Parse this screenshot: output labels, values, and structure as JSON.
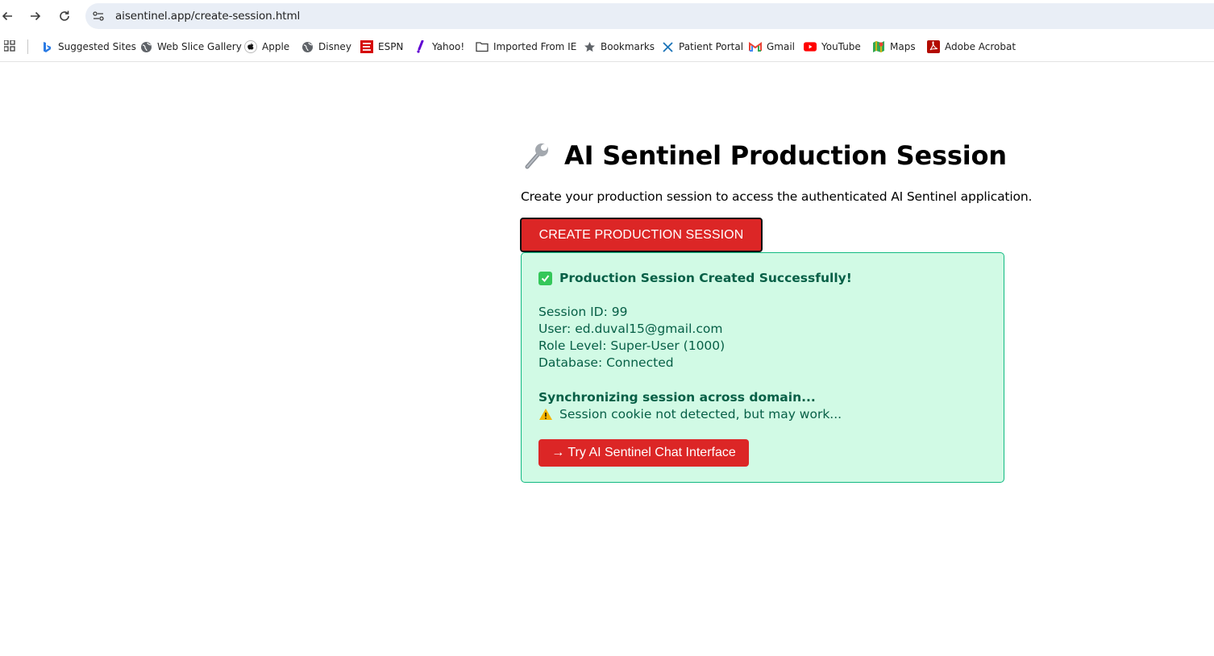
{
  "browser": {
    "url": "aisentinel.app/create-session.html",
    "bookmarks": [
      {
        "label": "Suggested Sites",
        "icon": "bing-icon"
      },
      {
        "label": "Web Slice Gallery",
        "icon": "globe-icon"
      },
      {
        "label": "Apple",
        "icon": "apple-icon"
      },
      {
        "label": "Disney",
        "icon": "globe-icon"
      },
      {
        "label": "ESPN",
        "icon": "espn-icon"
      },
      {
        "label": "Yahoo!",
        "icon": "yahoo-icon"
      },
      {
        "label": "Imported From IE",
        "icon": "folder-icon"
      },
      {
        "label": "Bookmarks",
        "icon": "star-icon"
      },
      {
        "label": "Patient Portal",
        "icon": "x-icon"
      },
      {
        "label": "Gmail",
        "icon": "gmail-icon"
      },
      {
        "label": "YouTube",
        "icon": "youtube-icon"
      },
      {
        "label": "Maps",
        "icon": "maps-icon"
      },
      {
        "label": "Adobe Acrobat",
        "icon": "acrobat-icon"
      }
    ]
  },
  "page": {
    "title": "AI Sentinel Production Session",
    "intro": "Create your production session to access the authenticated AI Sentinel application.",
    "create_button": "CREATE PRODUCTION SESSION"
  },
  "result": {
    "title": "Production Session Created Successfully!",
    "session_id": "Session ID: 99",
    "user": "User: ed.duval15@gmail.com",
    "role": "Role Level: Super-User (1000)",
    "database": "Database: Connected",
    "sync_title": "Synchronizing session across domain...",
    "warning": "Session cookie not detected, but may work...",
    "try_button": "→ Try AI Sentinel Chat Interface"
  },
  "colors": {
    "accent_red": "#dc2626",
    "success_bg": "#d1fae5",
    "success_border": "#10b981",
    "success_text": "#065f46"
  }
}
